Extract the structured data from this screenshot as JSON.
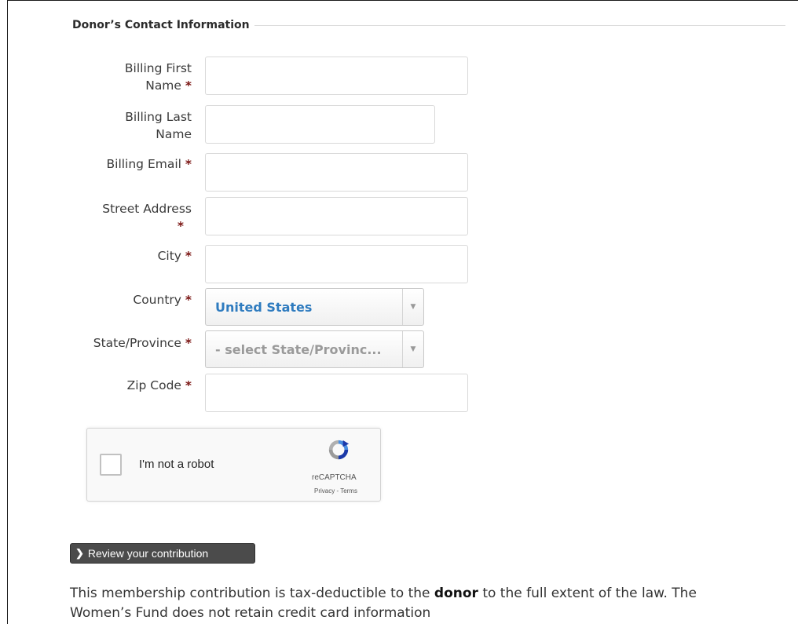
{
  "section": {
    "title": "Donor’s Contact Information"
  },
  "fields": {
    "first_name": {
      "label_line1": "Billing First",
      "label_line2": "Name",
      "required": "*",
      "value": ""
    },
    "last_name": {
      "label_line1": "Billing Last",
      "label_line2": "Name",
      "value": ""
    },
    "email": {
      "label": "Billing Email",
      "required": "*",
      "value": ""
    },
    "street": {
      "label": "Street Address",
      "required": "*",
      "value": ""
    },
    "city": {
      "label": "City",
      "required": "*",
      "value": ""
    },
    "country": {
      "label": "Country",
      "required": "*",
      "selected": "United States"
    },
    "state": {
      "label": "State/Province",
      "required": "*",
      "selected": "- select State/Provinc..."
    },
    "zip": {
      "label": "Zip Code",
      "required": "*",
      "value": ""
    }
  },
  "captcha": {
    "label": "I'm not a robot",
    "brand": "reCAPTCHA",
    "links": "Privacy - Terms"
  },
  "review_button": {
    "label": "Review your contribution"
  },
  "note": {
    "text_before": "This membership contribution is tax-deductible to the ",
    "bold": "donor",
    "text_after": " to the full extent of the law. The Women’s Fund does not retain credit card information"
  },
  "colors": {
    "required": "#7a1412",
    "country_value": "#2e7bbf",
    "state_placeholder": "#9a9a9a",
    "button_bg": "#4b4b4b"
  }
}
